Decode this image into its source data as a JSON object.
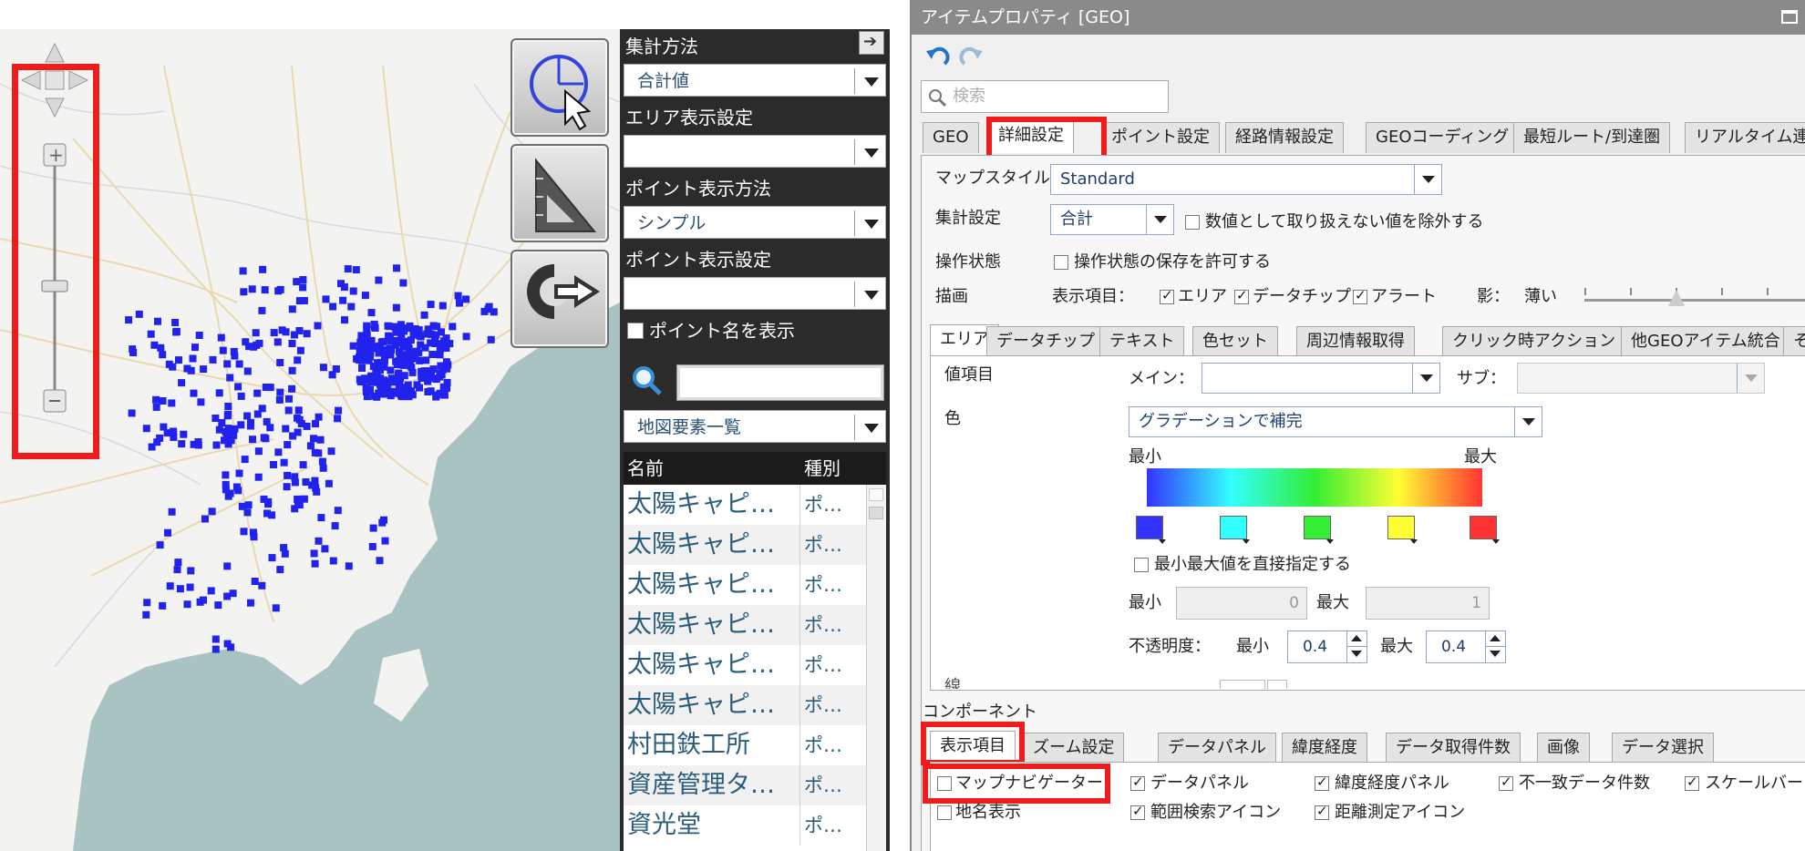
{
  "middle_panel": {
    "aggregate_label": "集計方法",
    "aggregate_value": "合計値",
    "area_display_label": "エリア表示設定",
    "area_display_value": "",
    "point_method_label": "ポイント表示方法",
    "point_method_value": "シンプル",
    "point_display_label": "ポイント表示設定",
    "point_display_value": "",
    "show_point_name_label": "ポイント名を表示",
    "show_point_name_checked": false,
    "search_value": "",
    "map_elements_value": "地図要素一覧",
    "list_columns": [
      "名前",
      "種別"
    ],
    "list_rows": [
      {
        "name": "太陽キャピ…",
        "type": "ポ…"
      },
      {
        "name": "太陽キャピ…",
        "type": "ポ…"
      },
      {
        "name": "太陽キャピ…",
        "type": "ポ…"
      },
      {
        "name": "太陽キャピ…",
        "type": "ポ…"
      },
      {
        "name": "太陽キャピ…",
        "type": "ポ…"
      },
      {
        "name": "太陽キャピ…",
        "type": "ポ…"
      },
      {
        "name": "村田鉄工所",
        "type": "ポ…"
      },
      {
        "name": "資産管理タ…",
        "type": "ポ…"
      },
      {
        "name": "資光堂",
        "type": "ポ…"
      }
    ]
  },
  "prop": {
    "title": "アイテムプロパティ [GEO]",
    "search_placeholder": "検索",
    "tabs": [
      "GEO",
      "詳細設定",
      "ポイント設定",
      "経路情報設定",
      "GEOコーディング",
      "最短ルート/到達圏",
      "リアルタイム連"
    ],
    "active_tab": "詳細設定",
    "map_style_label": "マップスタイル",
    "map_style_value": "Standard",
    "aggregate_label": "集計設定",
    "aggregate_value": "合計",
    "exclude_label": "数値として取り扱えない値を除外する",
    "exclude_checked": false,
    "op_state_label": "操作状態",
    "op_state_check_label": "操作状態の保存を許可する",
    "op_state_checked": false,
    "draw_label": "描画",
    "display_items_label": "表示項目：",
    "draw_area_label": "エリア",
    "draw_area_checked": true,
    "draw_datatip_label": "データチップ",
    "draw_datatip_checked": true,
    "draw_alert_label": "アラート",
    "draw_alert_checked": true,
    "shadow_label": "影：",
    "shadow_value": "薄い",
    "inner_tabs": [
      "エリア",
      "データチップ",
      "テキスト",
      "色セット",
      "周辺情報取得",
      "クリック時アクション",
      "他GEOアイテム統合",
      "そ"
    ],
    "inner_active_tab": "エリア",
    "value_item_label": "値項目",
    "main_label": "メイン：",
    "main_value": "",
    "sub_label": "サブ：",
    "sub_value": "",
    "color_label": "色",
    "color_mode_value": "グラデーションで補完",
    "min_label": "最小",
    "max_label": "最大",
    "gradient_colors": [
      "#3333ff",
      "#33ffff",
      "#33ee33",
      "#ffff33",
      "#ff3333"
    ],
    "direct_minmax_label": "最小最大値を直接指定する",
    "direct_minmax_checked": false,
    "min_value": "0",
    "max_value": "1",
    "opacity_label": "不透明度：",
    "opacity_min": "0.4",
    "opacity_max": "0.4",
    "cut_row_label": "線",
    "component_label": "コンポーネント",
    "comp_tabs": [
      "表示項目",
      "ズーム設定",
      "データパネル",
      "緯度経度",
      "データ取得件数",
      "画像",
      "データ選択"
    ],
    "comp_active_tab": "表示項目",
    "comp_checks": [
      {
        "label": "マップナビゲーター",
        "checked": false
      },
      {
        "label": "データパネル",
        "checked": true
      },
      {
        "label": "緯度経度パネル",
        "checked": true
      },
      {
        "label": "不一致データ件数",
        "checked": true
      },
      {
        "label": "スケールバー",
        "checked": true
      },
      {
        "label": "地名表示",
        "checked": false
      },
      {
        "label": "範囲検索アイコン",
        "checked": true
      },
      {
        "label": "距離測定アイコン",
        "checked": true
      }
    ]
  },
  "map": {
    "point_color": "#2222ee",
    "water_color": "#a9c3c3",
    "land_color": "#f3f3f1",
    "highlight_color": "#ef1c1c"
  }
}
